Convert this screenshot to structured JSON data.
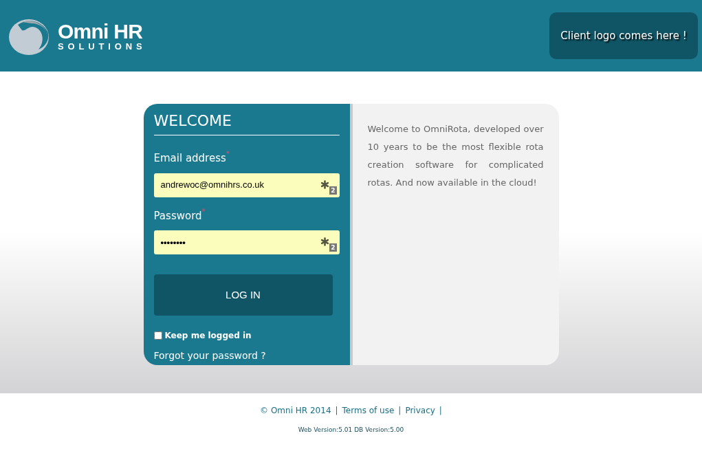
{
  "header": {
    "logo": {
      "name": "Omni HR",
      "tagline": "SOLUTIONS"
    },
    "client_logo": "Client logo comes here !"
  },
  "login": {
    "title": "WELCOME",
    "fields": [
      {
        "label": "Email address",
        "required_mark": "*",
        "value": "andrewoc@omnihrs.co.uk",
        "kind": "email",
        "badge": "2"
      },
      {
        "label": "Password",
        "required_mark": "*",
        "value": "••••••••",
        "kind": "password",
        "badge": "2"
      }
    ],
    "submit": "LOG IN",
    "remember": {
      "label": "Keep me logged in",
      "checked": false
    },
    "forgot": "Forgot your password ?"
  },
  "intro": "Welcome to OmniRota, developed over 10 years to be the most flexible rota creation software for complicated rotas. And now available in the cloud!",
  "footer": {
    "links": [
      {
        "text": "© Omni HR 2014"
      },
      {
        "text": "Terms of use"
      },
      {
        "text": "Privacy"
      }
    ],
    "separator": "|",
    "version": "Web Version:5.01 DB Version:5.00"
  }
}
